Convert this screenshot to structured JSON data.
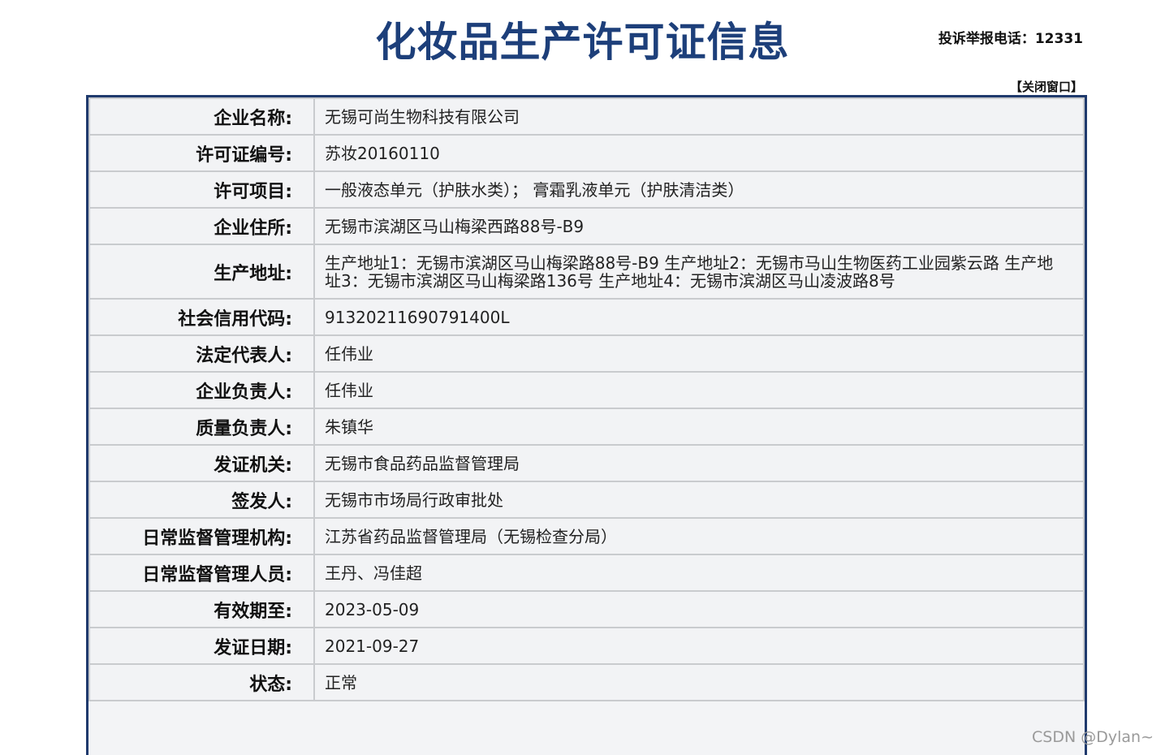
{
  "header": {
    "title": "化妆品生产许可证信息",
    "hotline": "投诉举报电话：12331",
    "close_link": "【关闭窗口】"
  },
  "fields": [
    {
      "label": "企业名称:",
      "value": "无锡可尚生物科技有限公司"
    },
    {
      "label": "许可证编号:",
      "value": "苏妆20160110"
    },
    {
      "label": "许可项目:",
      "value": "一般液态单元（护肤水类）；  膏霜乳液单元（护肤清洁类）"
    },
    {
      "label": "企业住所:",
      "value": "无锡市滨湖区马山梅梁西路88号-B9"
    },
    {
      "label": "生产地址:",
      "value": "生产地址1：无锡市滨湖区马山梅梁路88号-B9 生产地址2：无锡市马山生物医药工业园紫云路 生产地址3：无锡市滨湖区马山梅梁路136号 生产地址4：无锡市滨湖区马山凌波路8号"
    },
    {
      "label": "社会信用代码:",
      "value": "91320211690791400L"
    },
    {
      "label": "法定代表人:",
      "value": "任伟业"
    },
    {
      "label": "企业负责人:",
      "value": "任伟业"
    },
    {
      "label": "质量负责人:",
      "value": "朱镇华"
    },
    {
      "label": "发证机关:",
      "value": "无锡市食品药品监督管理局"
    },
    {
      "label": "签发人:",
      "value": "无锡市市场局行政审批处"
    },
    {
      "label": "日常监督管理机构:",
      "value": "江苏省药品监督管理局（无锡检查分局）"
    },
    {
      "label": "日常监督管理人员:",
      "value": "王丹、冯佳超"
    },
    {
      "label": "有效期至:",
      "value": "2023-05-09"
    },
    {
      "label": "发证日期:",
      "value": "2021-09-27"
    },
    {
      "label": "状态:",
      "value": "正常"
    }
  ],
  "watermark": "CSDN @Dylan~"
}
